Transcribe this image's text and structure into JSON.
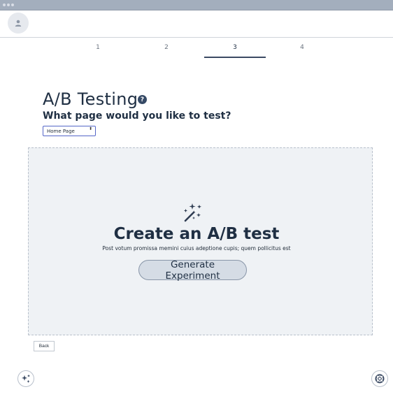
{
  "stepper": {
    "steps": [
      "1",
      "2",
      "3",
      "4"
    ],
    "active_index": 2
  },
  "page": {
    "title": "A/B Testing",
    "help_glyph": "?",
    "question": "What page would you like to test?"
  },
  "page_select": {
    "value": "Home Page",
    "arrow": "⬍"
  },
  "empty_state": {
    "icon": "magic-wand-icon",
    "title": "Create an A/B test",
    "description": "Post votum promissa memini cuius adeptione cupis; quem pollicitus est",
    "button_label": "Generate Experiment"
  },
  "footer": {
    "back_label": "Back"
  },
  "icons": {
    "avatar": "user-icon",
    "left_fab": "sparkles-icon",
    "right_fab": "lifebuoy-icon"
  },
  "colors": {
    "accent": "#3b4a63",
    "panel_bg": "#eff2f5",
    "select_border": "#5466c7",
    "chrome": "#a3aebd"
  }
}
